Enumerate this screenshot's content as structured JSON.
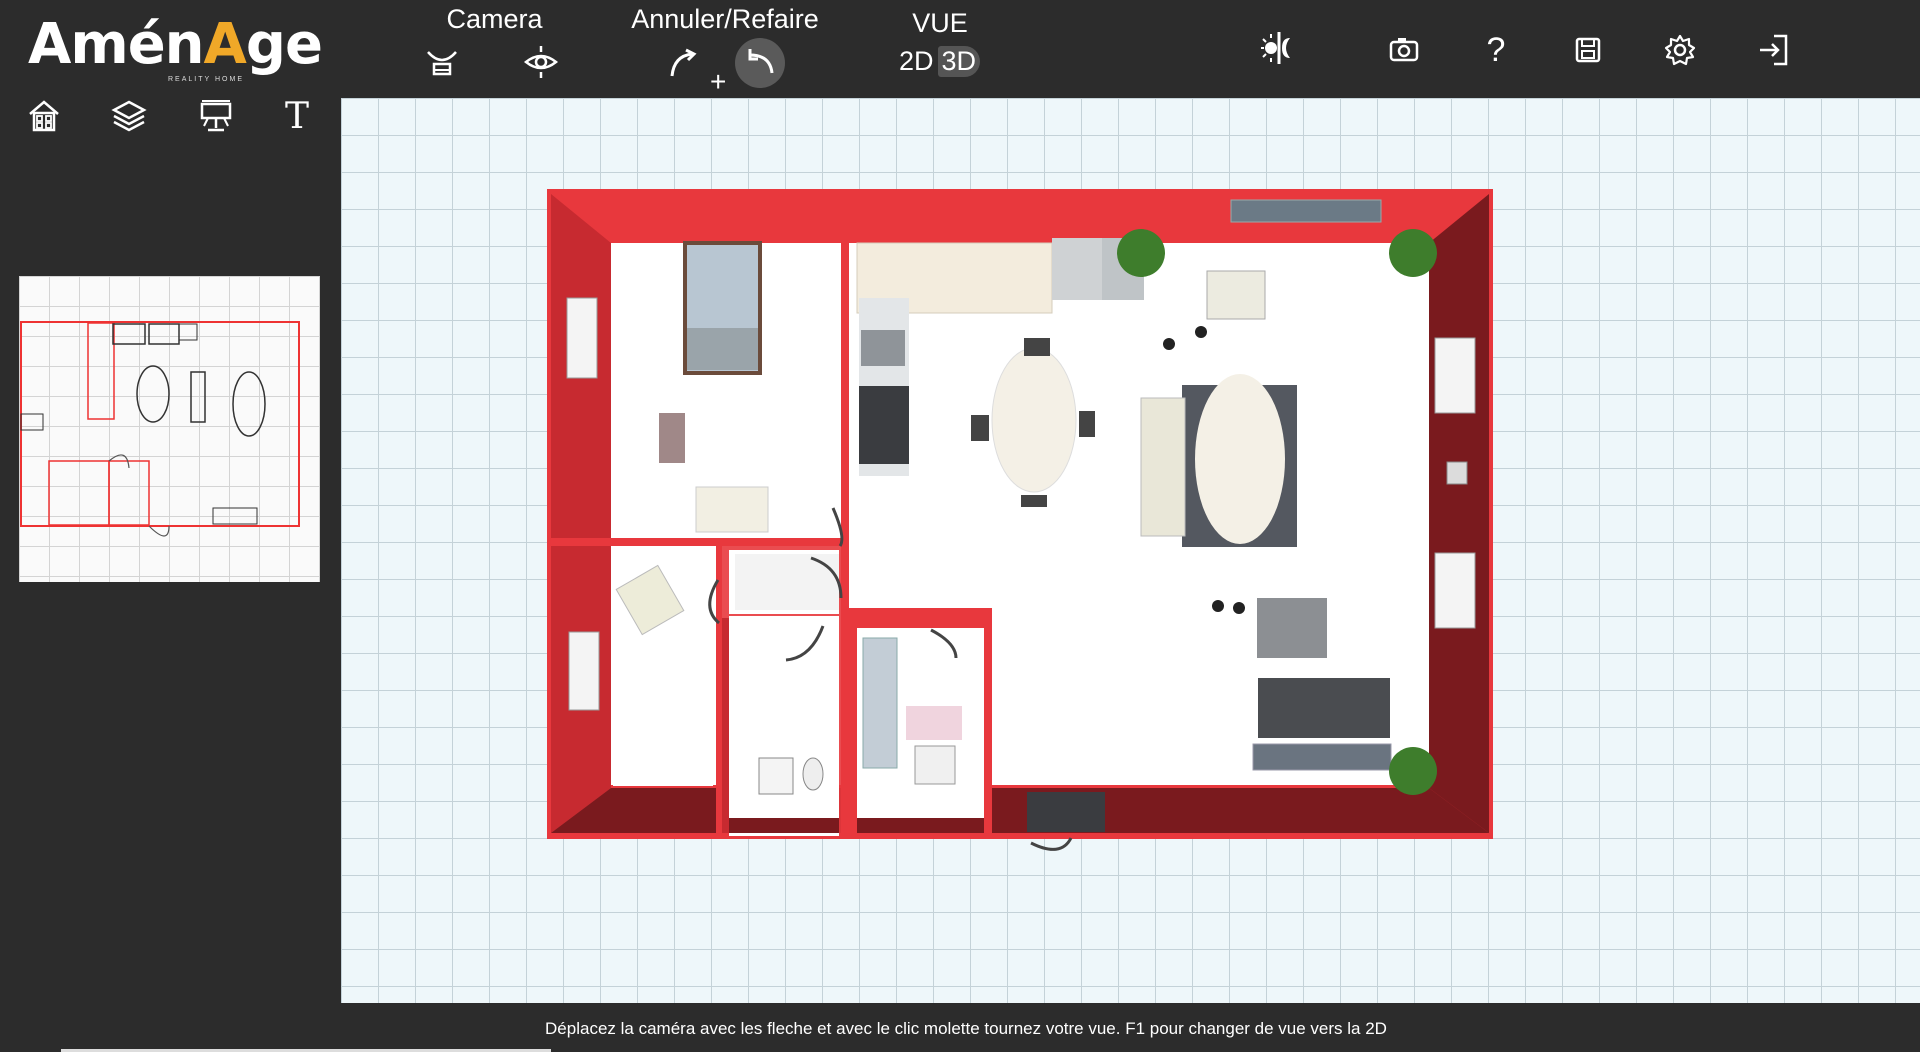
{
  "app": {
    "logo_text_pre": "Amén",
    "logo_text_a": "A",
    "logo_text_post": "ge",
    "logo_subtitle": "REALITY HOME"
  },
  "toolbar": {
    "camera_title": "Camera",
    "undo_title": "Annuler/Refaire",
    "plus_label": "+",
    "view_title": "VUE",
    "view_2d": "2D",
    "view_3d": "3D",
    "active_view": "3D",
    "help_label": "?"
  },
  "sidebar": {
    "text_tool_label": "T"
  },
  "status": {
    "message": "Déplacez la caméra avec les fleche et avec le clic molette tournez votre vue. F1 pour changer de vue vers la 2D"
  },
  "colors": {
    "background": "#2c2c2c",
    "wall": "#e8383d",
    "wall_shadow": "#7a1a1e",
    "canvas": "#eef7fa",
    "accent_logo": "#f0a828"
  }
}
